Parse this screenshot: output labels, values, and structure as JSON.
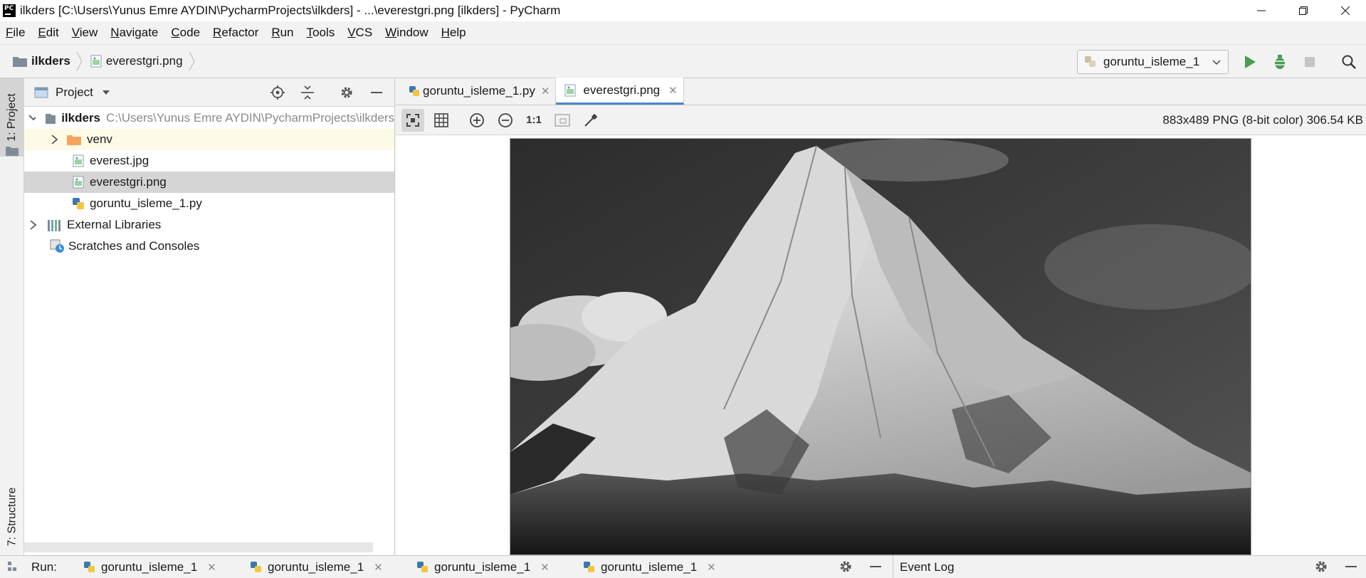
{
  "window": {
    "title": "ilkders [C:\\Users\\Yunus Emre AYDIN\\PycharmProjects\\ilkders] - ...\\everestgri.png [ilkders] - PyCharm",
    "app_icon_text": "PC"
  },
  "menu": [
    "File",
    "Edit",
    "View",
    "Navigate",
    "Code",
    "Refactor",
    "Run",
    "Tools",
    "VCS",
    "Window",
    "Help"
  ],
  "breadcrumb": {
    "project": "ilkders",
    "file": "everestgri.png"
  },
  "run_config": {
    "label": "goruntu_isleme_1"
  },
  "left_stripe": {
    "project_tab": "1: Project",
    "structure_tab": "7: Structure"
  },
  "project_panel": {
    "title": "Project",
    "tree": {
      "root_name": "ilkders",
      "root_path": "C:\\Users\\Yunus Emre AYDIN\\PycharmProjects\\ilkders",
      "items": [
        {
          "label": "venv",
          "type": "folder"
        },
        {
          "label": "everest.jpg",
          "type": "image"
        },
        {
          "label": "everestgri.png",
          "type": "image",
          "selected": true
        },
        {
          "label": "goruntu_isleme_1.py",
          "type": "python"
        }
      ],
      "external_libraries": "External Libraries",
      "scratches": "Scratches and Consoles"
    }
  },
  "editor": {
    "tabs": [
      {
        "label": "goruntu_isleme_1.py",
        "active": false
      },
      {
        "label": "everestgri.png",
        "active": true
      }
    ],
    "image_info": "883x489 PNG (8-bit color) 306.54 KB",
    "zoom_actual_label": "1:1"
  },
  "bottom": {
    "run_label": "Run:",
    "run_tabs": [
      "goruntu_isleme_1",
      "goruntu_isleme_1",
      "goruntu_isleme_1",
      "goruntu_isleme_1"
    ],
    "event_log": "Event Log"
  },
  "colors": {
    "accent": "#4a88c7",
    "run_green": "#499c54",
    "folder_orange": "#f4a460",
    "venv_highlight": "#fdfbe6",
    "selected_row": "#d5d5d5"
  }
}
